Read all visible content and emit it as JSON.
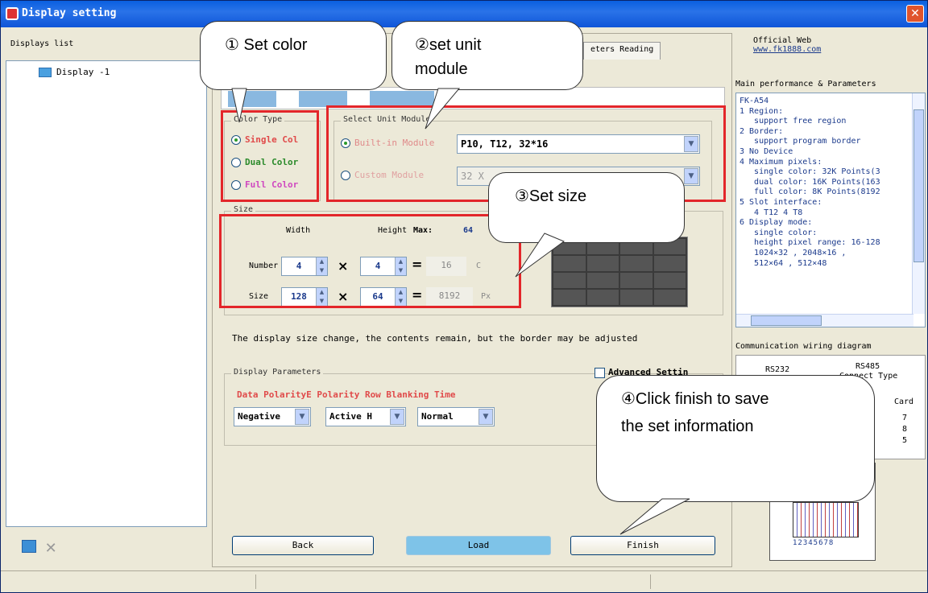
{
  "window": {
    "title": "Display setting",
    "close_symbol": "✕"
  },
  "displays_list": {
    "header": "Displays list",
    "items": [
      "Display -1"
    ]
  },
  "tabs": {
    "visible_tab": "eters Reading"
  },
  "color_type": {
    "legend": "Color Type",
    "options": [
      {
        "label": "Single Col",
        "selected": true,
        "color": "#e04a4a"
      },
      {
        "label": "Dual Color",
        "selected": false,
        "color": "#2a8a2a"
      },
      {
        "label": "Full Color",
        "selected": false,
        "color": "#d048c0"
      }
    ]
  },
  "unit_module": {
    "legend": "Select Unit Module",
    "builtin_label": "Built-in Module",
    "builtin_value": "P10, T12, 32*16",
    "custom_label": "Custom Module",
    "custom_value": "32 X"
  },
  "size": {
    "legend": "Size",
    "width_header": "Width",
    "height_header": "Height",
    "max_label": "Max:",
    "max_value": "64",
    "number_label": "Number",
    "size_label": "Size",
    "number_width": "4",
    "number_height": "4",
    "number_result": "16",
    "number_unit": "C",
    "size_width": "128",
    "size_height": "64",
    "size_result": "8192",
    "size_unit": "Px",
    "times_symbol": "×",
    "equals_symbol": "="
  },
  "note": "The display size change,  the contents remain,  but the border may be adjusted",
  "advanced_setting_label": "Advanced Settin",
  "display_parameters": {
    "legend": "Display Parameters",
    "header": "Data PolarityE Polarity Row Blanking Time",
    "data_polarity": "Negative",
    "e_polarity": "Active H",
    "blanking": "Normal"
  },
  "buttons": {
    "back": "Back",
    "load": "Load",
    "finish": "Finish"
  },
  "right_panel": {
    "official_web_label": "Official Web",
    "official_web_url": "www.fk1888.com",
    "params_title": "Main performance & Parameters",
    "params_text": "FK-A54\n1 Region:\n   support free region\n2 Border:\n   support program border\n3 No Device\n4 Maximum pixels:\n   single color: 32K Points(3\n   dual color: 16K Points(163\n   full color: 8K Points(8192\n5 Slot interface:\n   4 T12 4 T8\n6 Display mode:\n   single color:\n   height pixel range: 16-128\n   1024×32 , 2048×16 ,\n   512×64 , 512×48",
    "comm_title": "Communication wiring diagram",
    "comm_rs232": "RS232",
    "comm_rs485": "RS485",
    "comm_connect_type": "Connect Type",
    "comm_card": "Card",
    "comm_pins": [
      "7",
      "8",
      "5"
    ],
    "ribbon_digits": "12345678"
  },
  "callouts": {
    "c1": "① Set color",
    "c2_line1": "②set unit",
    "c2_line2": "module",
    "c3": "③Set size",
    "c4_line1": "④Click finish to save",
    "c4_line2": "the set information"
  }
}
